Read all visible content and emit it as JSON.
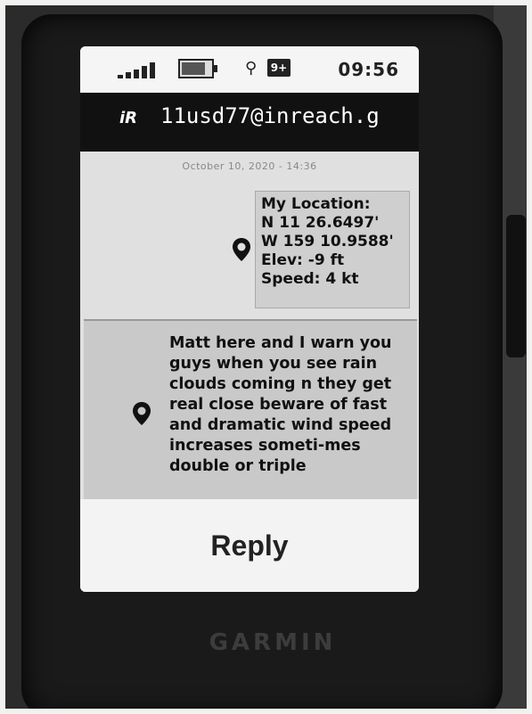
{
  "status_bar": {
    "time": "09:56",
    "message_badge": "9+",
    "icons": [
      "signal-icon",
      "battery-icon",
      "gps-icon",
      "message-icon"
    ]
  },
  "header": {
    "service_icon": "iR",
    "contact": "11usd77@inreach.g"
  },
  "conversation": {
    "timestamp": "October 10, 2020 - 14:36",
    "location": {
      "text": "My Location:\nN 11 26.6497'\nW 159 10.9588'\nElev: -9 ft\nSpeed: 4 kt"
    },
    "message": {
      "text": "Matt here and I warn you guys when you see rain clouds coming n they get real close beware of fast and dramatic wind speed increases someti-mes double or triple"
    }
  },
  "reply": {
    "label": "Reply"
  },
  "device": {
    "brand": "GARMIN"
  }
}
